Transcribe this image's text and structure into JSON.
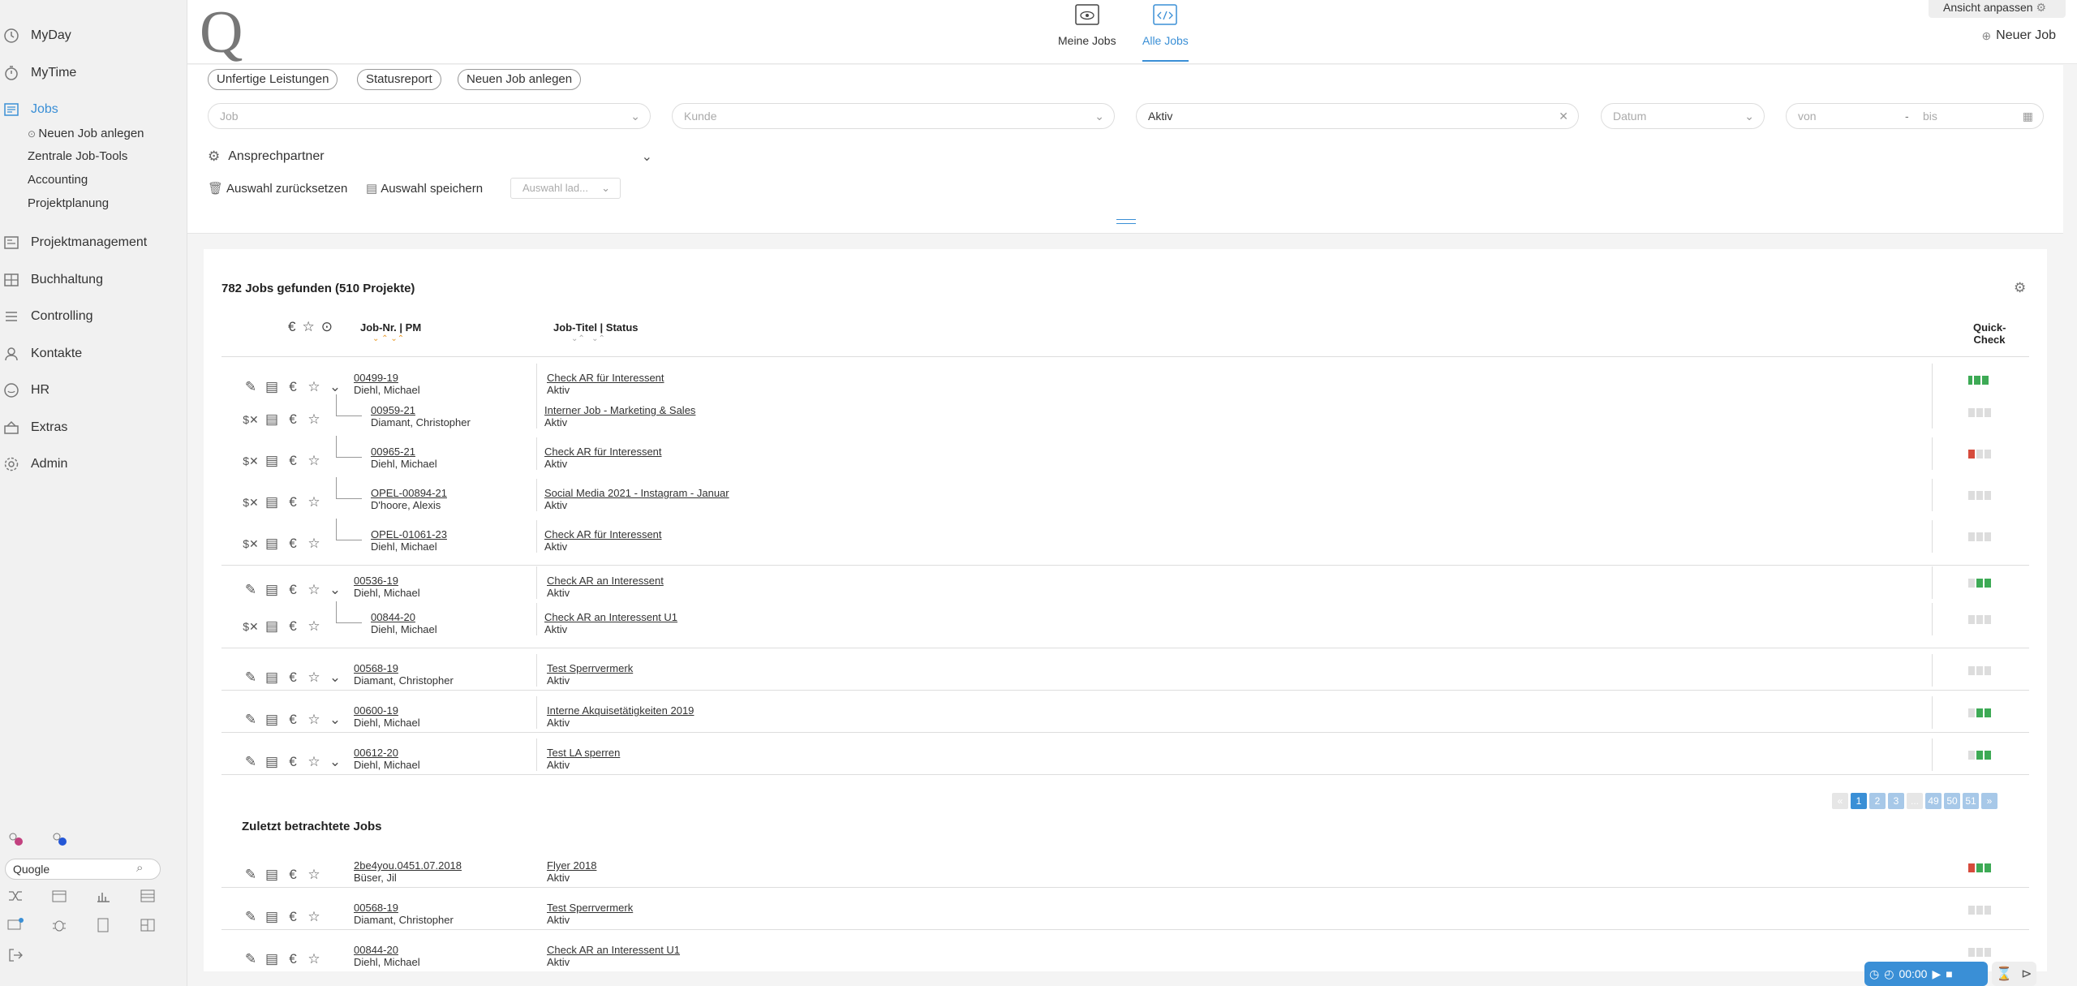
{
  "sidebar": {
    "items": [
      {
        "label": "MyDay",
        "icon": "clock-icon"
      },
      {
        "label": "MyTime",
        "icon": "stopwatch-icon"
      },
      {
        "label": "Jobs",
        "icon": "jobs-icon"
      },
      {
        "label": "Projektmanagement",
        "icon": "projects-icon"
      },
      {
        "label": "Buchhaltung",
        "icon": "ledger-icon"
      },
      {
        "label": "Controlling",
        "icon": "list-icon"
      },
      {
        "label": "Kontakte",
        "icon": "person-icon"
      },
      {
        "label": "HR",
        "icon": "smile-icon"
      },
      {
        "label": "Extras",
        "icon": "box-icon"
      },
      {
        "label": "Admin",
        "icon": "gear-icon"
      }
    ],
    "subitems": [
      "Neuen Job anlegen",
      "Zentrale Job-Tools",
      "Accounting",
      "Projektplanung"
    ],
    "search_value": "Quogle"
  },
  "topbar": {
    "logo": "Q",
    "tabs": [
      "Meine Jobs",
      "Alle Jobs"
    ],
    "active_tab": "Alle Jobs",
    "customize": "Ansicht anpassen",
    "new_job": "Neuer Job"
  },
  "filters": {
    "pills": [
      "Unfertige Leistungen",
      "Statusreport",
      "Neuen Job anlegen"
    ],
    "job_placeholder": "Job",
    "kunde_placeholder": "Kunde",
    "status_value": "Aktiv",
    "datum_placeholder": "Datum",
    "von_placeholder": "von",
    "bis_placeholder": "bis",
    "dash": "-",
    "contact_label": "Ansprechpartner",
    "reset": "Auswahl zurücksetzen",
    "save": "Auswahl speichern",
    "load_placeholder": "Auswahl lad..."
  },
  "results": {
    "count_title": "782 Jobs gefunden (510 Projekte)",
    "col_jobnr": "Job-Nr. | PM",
    "col_title": "Job-Titel | Status",
    "col_quick": "Quick-",
    "col_check": "Check",
    "rows": [
      {
        "nr": "00499-19",
        "pm": "Diehl, Michael",
        "title": "Check AR für Interessent",
        "status": "Aktiv",
        "level": 0,
        "qc": [
          "h",
          "g",
          "g"
        ]
      },
      {
        "nr": "00959-21",
        "pm": "Diamant, Christopher",
        "title": "Interner Job - Marketing & Sales",
        "status": "Aktiv",
        "level": 1,
        "qc": [
          "n",
          "n",
          "n"
        ]
      },
      {
        "nr": "00965-21",
        "pm": "Diehl, Michael",
        "title": "Check AR für Interessent",
        "status": "Aktiv",
        "level": 1,
        "qc": [
          "r",
          "n",
          "n"
        ]
      },
      {
        "nr": "OPEL-00894-21",
        "pm": "D'hoore, Alexis",
        "title": "Social Media 2021 - Instagram - Januar",
        "status": "Aktiv",
        "level": 1,
        "qc": [
          "n",
          "n",
          "n"
        ]
      },
      {
        "nr": "OPEL-01061-23",
        "pm": "Diehl, Michael",
        "title": "Check AR für Interessent",
        "status": "Aktiv",
        "level": 1,
        "qc": [
          "n",
          "n",
          "n"
        ]
      },
      {
        "nr": "00536-19",
        "pm": "Diehl, Michael",
        "title": "Check AR an Interessent",
        "status": "Aktiv",
        "level": 0,
        "qc": [
          "n",
          "g",
          "g"
        ]
      },
      {
        "nr": "00844-20",
        "pm": "Diehl, Michael",
        "title": "Check AR an Interessent U1",
        "status": "Aktiv",
        "level": 1,
        "qc": [
          "n",
          "n",
          "n"
        ]
      },
      {
        "nr": "00568-19",
        "pm": "Diamant, Christopher",
        "title": "Test Sperrvermerk",
        "status": "Aktiv",
        "level": 0,
        "qc": [
          "n",
          "n",
          "n"
        ]
      },
      {
        "nr": "00600-19",
        "pm": "Diehl, Michael",
        "title": "Interne Akquisetätigkeiten 2019",
        "status": "Aktiv",
        "level": 0,
        "qc": [
          "n",
          "g",
          "g"
        ]
      },
      {
        "nr": "00612-20",
        "pm": "Diehl, Michael",
        "title": "Test LA sperren",
        "status": "Aktiv",
        "level": 0,
        "qc": [
          "n",
          "g",
          "g"
        ]
      }
    ],
    "pagination": [
      "«",
      "1",
      "2",
      "3",
      "...",
      "49",
      "50",
      "51",
      "»"
    ],
    "current_page": "1"
  },
  "recent": {
    "title": "Zuletzt betrachtete Jobs",
    "rows": [
      {
        "nr": "2be4you.0451.07.2018",
        "pm": "Büser, Jil",
        "title": "Flyer 2018",
        "status": "Aktiv",
        "qc": [
          "r",
          "g",
          "g"
        ]
      },
      {
        "nr": "00568-19",
        "pm": "Diamant, Christopher",
        "title": "Test Sperrvermerk",
        "status": "Aktiv",
        "qc": [
          "n",
          "n",
          "n"
        ]
      },
      {
        "nr": "00844-20",
        "pm": "Diehl, Michael",
        "title": "Check AR an Interessent U1",
        "status": "Aktiv",
        "qc": [
          "n",
          "n",
          "n"
        ]
      }
    ]
  },
  "timer": {
    "value": "00:00"
  },
  "colors": {
    "accent": "#3a8fd6",
    "green": "#3daa55",
    "red": "#d64b3c"
  }
}
